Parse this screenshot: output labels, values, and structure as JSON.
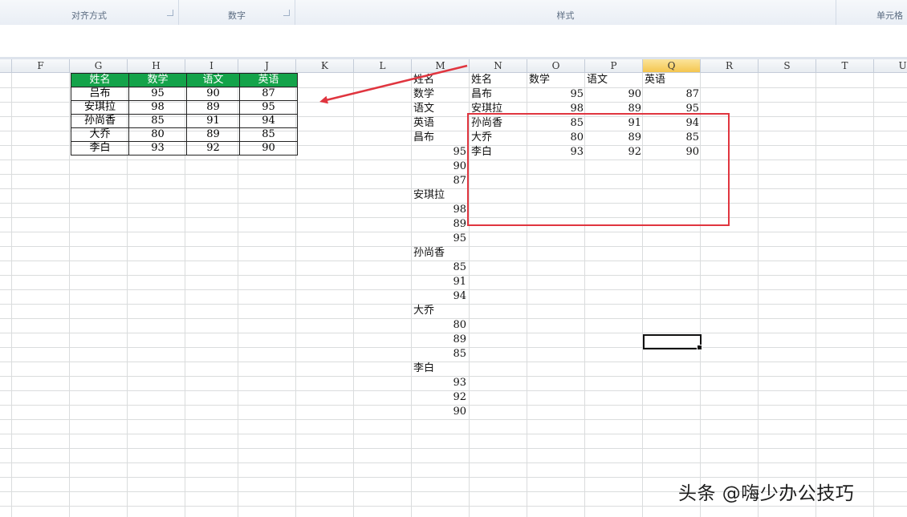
{
  "ribbon": {
    "groups": [
      {
        "label": "对齐方式"
      },
      {
        "label": "数字"
      },
      {
        "label": "样式"
      },
      {
        "label": "单元格"
      }
    ]
  },
  "columns": [
    "F",
    "G",
    "H",
    "I",
    "J",
    "K",
    "L",
    "M",
    "N",
    "O",
    "P",
    "Q",
    "R",
    "S",
    "T",
    "U"
  ],
  "selected_column": "Q",
  "source_table": {
    "headers": [
      "姓名",
      "数学",
      "语文",
      "英语"
    ],
    "rows": [
      [
        "吕布",
        "95",
        "90",
        "87"
      ],
      [
        "安琪拉",
        "98",
        "89",
        "95"
      ],
      [
        "孙尚香",
        "85",
        "91",
        "94"
      ],
      [
        "大乔",
        "80",
        "89",
        "85"
      ],
      [
        "李白",
        "93",
        "92",
        "90"
      ]
    ]
  },
  "column_m": {
    "labels": [
      "姓名",
      "数学",
      "语文",
      "英语",
      "昌布"
    ],
    "entries": [
      {
        "value": "95",
        "align": "right"
      },
      {
        "value": "90",
        "align": "right"
      },
      {
        "value": "87",
        "align": "right"
      },
      {
        "value": "安琪拉",
        "align": "left"
      },
      {
        "value": "98",
        "align": "right"
      },
      {
        "value": "89",
        "align": "right"
      },
      {
        "value": "95",
        "align": "right"
      },
      {
        "value": "孙尚香",
        "align": "left"
      },
      {
        "value": "85",
        "align": "right"
      },
      {
        "value": "91",
        "align": "right"
      },
      {
        "value": "94",
        "align": "right"
      },
      {
        "value": "大乔",
        "align": "left"
      },
      {
        "value": "80",
        "align": "right"
      },
      {
        "value": "89",
        "align": "right"
      },
      {
        "value": "85",
        "align": "right"
      },
      {
        "value": "李白",
        "align": "left"
      },
      {
        "value": "93",
        "align": "right"
      },
      {
        "value": "92",
        "align": "right"
      },
      {
        "value": "90",
        "align": "right"
      }
    ]
  },
  "result_table": {
    "headers": [
      "姓名",
      "数学",
      "语文",
      "英语"
    ],
    "rows": [
      [
        "昌布",
        "95",
        "90",
        "87"
      ],
      [
        "安琪拉",
        "98",
        "89",
        "95"
      ],
      [
        "孙尚香",
        "85",
        "91",
        "94"
      ],
      [
        "大乔",
        "80",
        "89",
        "85"
      ],
      [
        "李白",
        "93",
        "92",
        "90"
      ]
    ]
  },
  "colors": {
    "header_green": "#14a34a",
    "annotation_red": "#e0353f",
    "selected_col": "#f4c54f"
  },
  "watermark": "头条 @嗨少办公技巧"
}
